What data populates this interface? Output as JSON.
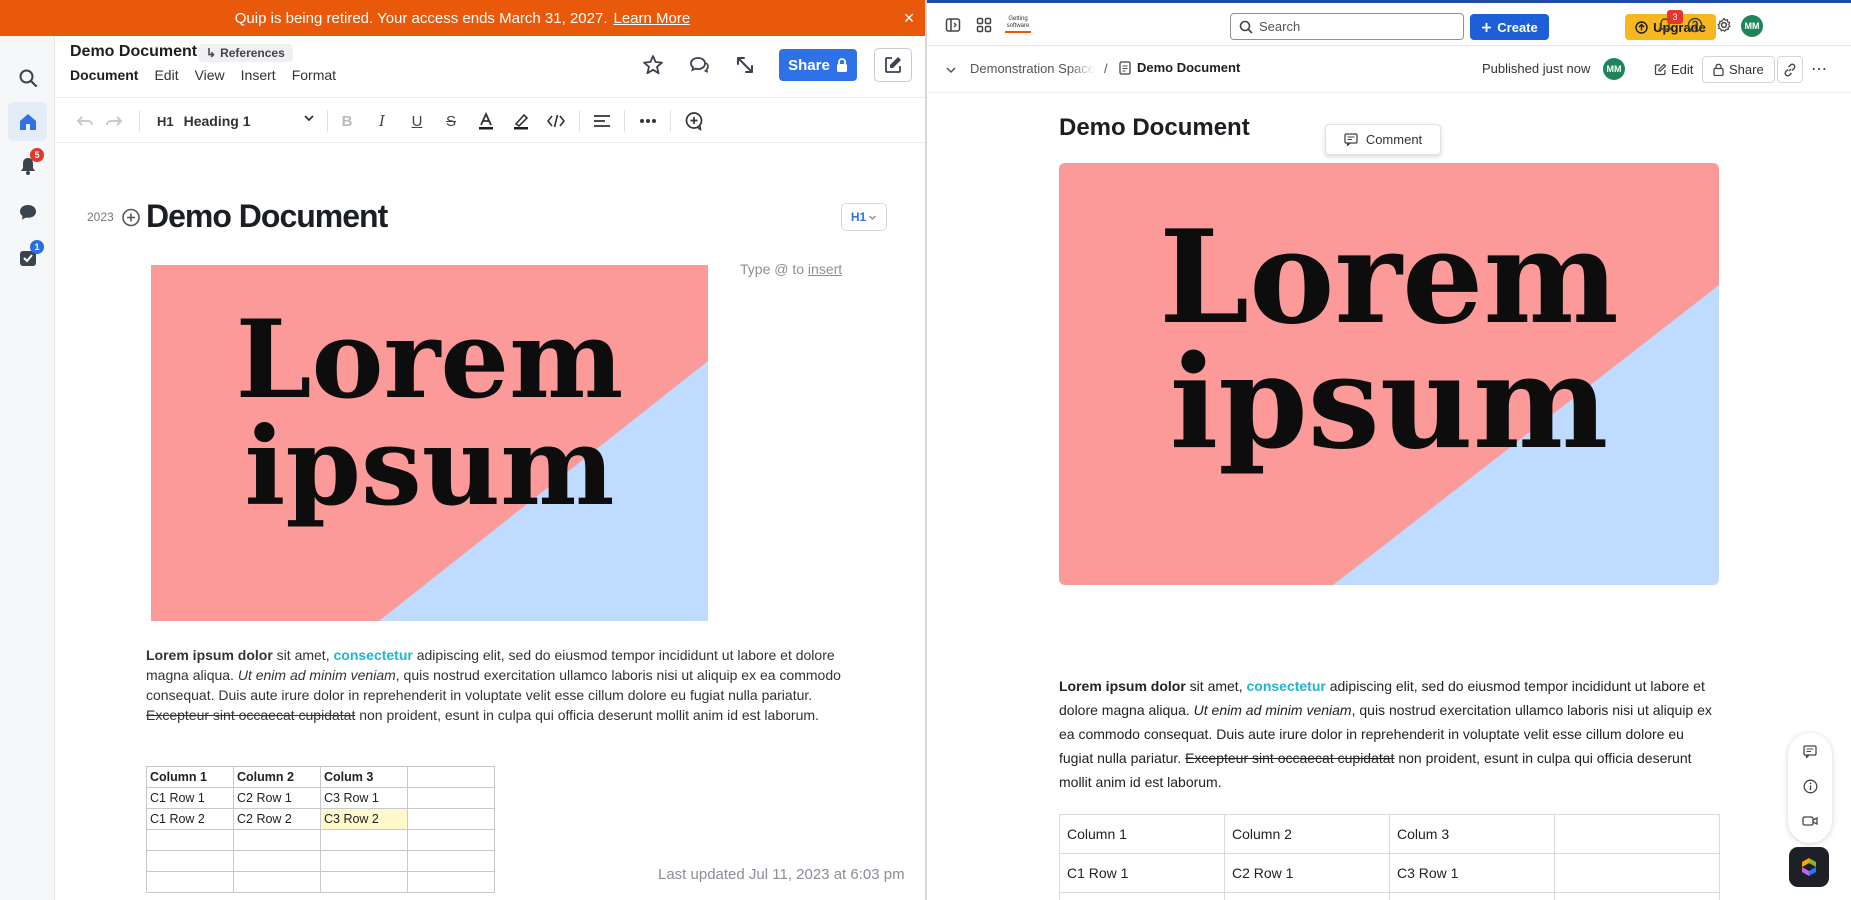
{
  "quip": {
    "banner": {
      "text": "Quip is being retired. Your access ends March 31, 2027.",
      "link": "Learn More"
    },
    "rail": {
      "notifications_badge": "5",
      "tasks_badge": "1"
    },
    "doc_title": "Demo Document",
    "references_label": "References",
    "menu": [
      "Document",
      "Edit",
      "View",
      "Insert",
      "Format"
    ],
    "share_label": "Share",
    "toolbar": {
      "style_prefix": "H1",
      "style_label": "Heading 1"
    },
    "year": "2023",
    "h1_badge": "H1",
    "heading": "Demo Document",
    "type_hint_prefix": "Type @ to",
    "type_hint_link": "insert",
    "image": {
      "line1": "Lorem",
      "line2": "ipsum"
    },
    "paragraph": {
      "bold": "Lorem ipsum dolor",
      "t1": " sit amet, ",
      "link": "consectetur",
      "t2": " adipiscing elit, sed do eiusmod tempor incididunt ut labore et dolore magna aliqua. ",
      "italic": "Ut enim ad minim veniam",
      "t3": ", quis nostrud exercitation ullamco laboris nisi ut aliquip ex ea commodo consequat. Duis aute irure dolor in reprehenderit in voluptate velit esse cillum dolore eu fugiat nulla pariatur. ",
      "strike": "Excepteur sint occaecat cupidatat",
      "t4": " non proident, esunt in culpa qui officia deserunt mollit anim id est laborum."
    },
    "table": {
      "rows": [
        [
          "Column 1",
          "Column 2",
          "Colum 3",
          ""
        ],
        [
          "C1 Row 1",
          "C2 Row 1",
          "C3 Row 1",
          ""
        ],
        [
          "C1 Row 2",
          "C2 Row 2",
          "C3 Row 2",
          ""
        ],
        [
          "",
          "",
          "",
          ""
        ],
        [
          "",
          "",
          "",
          ""
        ],
        [
          "",
          "",
          "",
          ""
        ]
      ]
    },
    "last_updated": "Last updated Jul 11, 2023 at 6:03 pm"
  },
  "confluence": {
    "logo_text": "Getting software",
    "search_placeholder": "Search",
    "create_label": "Create",
    "upgrade_label": "Upgrade",
    "bell_badge": "3",
    "avatar_initials": "MM",
    "breadcrumb": {
      "space": "Demonstration Space",
      "separator": "/",
      "page": "Demo Document"
    },
    "published": "Published just now",
    "edit_label": "Edit",
    "share_label": "Share",
    "heading": "Demo Document",
    "comment_label": "Comment",
    "image": {
      "line1": "Lorem",
      "line2": "ipsum"
    },
    "paragraph": {
      "bold": "Lorem ipsum dolor",
      "t1": " sit amet, ",
      "link": "consectetur",
      "t2": " adipiscing elit, sed do eiusmod tempor incididunt ut labore et dolore magna aliqua. ",
      "italic": "Ut enim ad minim veniam",
      "t3": ", quis nostrud exercitation ullamco laboris nisi ut aliquip ex ea commodo consequat. Duis aute irure dolor in reprehenderit in voluptate velit esse cillum dolore eu fugiat nulla pariatur. ",
      "strike": "Excepteur sint occaecat cupidatat",
      "t4": " non proident, esunt in culpa qui officia deserunt mollit anim id est laborum."
    },
    "table": {
      "rows": [
        [
          "Column 1",
          "Column 2",
          "Colum 3",
          ""
        ],
        [
          "C1 Row 1",
          "C2 Row 1",
          "C3 Row 1",
          ""
        ]
      ]
    }
  },
  "colors": {
    "quip_banner": "#e8590c",
    "quip_share": "#2f72e8",
    "confluence_create": "#1d5fd6",
    "confluence_upgrade": "#f7b81d",
    "image_pink": "#fb9a98",
    "image_blue": "#bfdbff",
    "link_cyan": "#23b4d4"
  }
}
